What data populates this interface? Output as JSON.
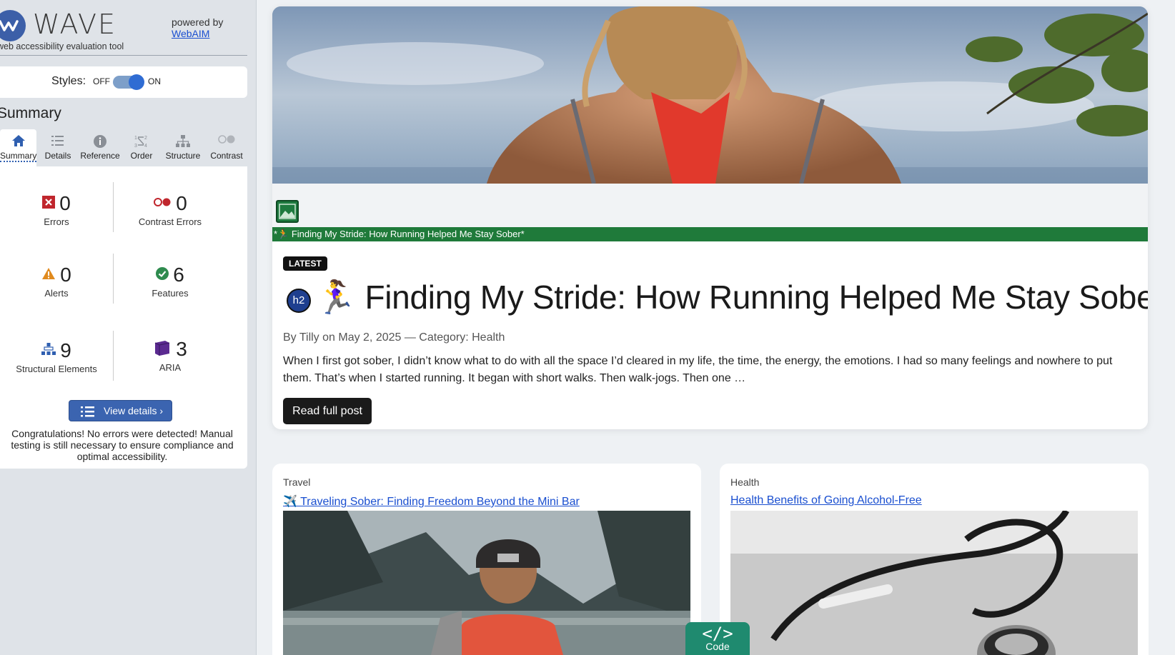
{
  "wave": {
    "brand": "WAVE",
    "tagline": "web accessibility evaluation tool",
    "powered_by": "powered by",
    "powered_link": "WebAIM",
    "styles_label": "Styles:",
    "styles_off": "OFF",
    "styles_on": "ON",
    "summary_heading": "Summary",
    "tabs": [
      {
        "label": "Summary",
        "icon": "home-icon"
      },
      {
        "label": "Details",
        "icon": "list-icon"
      },
      {
        "label": "Reference",
        "icon": "info-icon"
      },
      {
        "label": "Order",
        "icon": "order-icon"
      },
      {
        "label": "Structure",
        "icon": "structure-icon"
      },
      {
        "label": "Contrast",
        "icon": "contrast-icon"
      }
    ],
    "stats": {
      "errors": {
        "count": "0",
        "label": "Errors"
      },
      "contrast_errors": {
        "count": "0",
        "label": "Contrast Errors"
      },
      "alerts": {
        "count": "0",
        "label": "Alerts"
      },
      "features": {
        "count": "6",
        "label": "Features"
      },
      "structural": {
        "count": "9",
        "label": "Structural Elements"
      },
      "aria": {
        "count": "3",
        "label": "ARIA"
      }
    },
    "view_details": "View details ›",
    "congrats": "Congratulations! No errors were detected! Manual testing is still necessary to ensure compliance and optimal accessibility."
  },
  "hero": {
    "alt_bar": "*🏃 Finding My Stride: How Running Helped Me Stay Sober*",
    "badge": "LATEST",
    "h2_marker": "h2",
    "title": "🏃‍♀️ Finding My Stride: How Running Helped Me Stay Sober",
    "byline": "By Tilly on May 2, 2025 — Category: Health",
    "excerpt": "When I first got sober, I didn’t know what to do with all the space I’d cleared in my life, the time, the energy, the emotions. I had so many feelings and nowhere to put them. That’s when I started running. It began with short walks. Then walk-jogs. Then one …",
    "read_more": "Read full post"
  },
  "cards": [
    {
      "category": "Travel",
      "title": "✈️ Traveling Sober: Finding Freedom Beyond the Mini Bar"
    },
    {
      "category": "Health",
      "title": "Health Benefits of Going Alcohol-Free"
    }
  ],
  "code_tab": {
    "symbol": "</>",
    "label": "Code"
  },
  "colors": {
    "wave_blue": "#3b64b0",
    "feature_green": "#1f7a3a",
    "error_red": "#c0262d",
    "alert_orange": "#e08a1e",
    "code_teal": "#1f8a6f"
  }
}
